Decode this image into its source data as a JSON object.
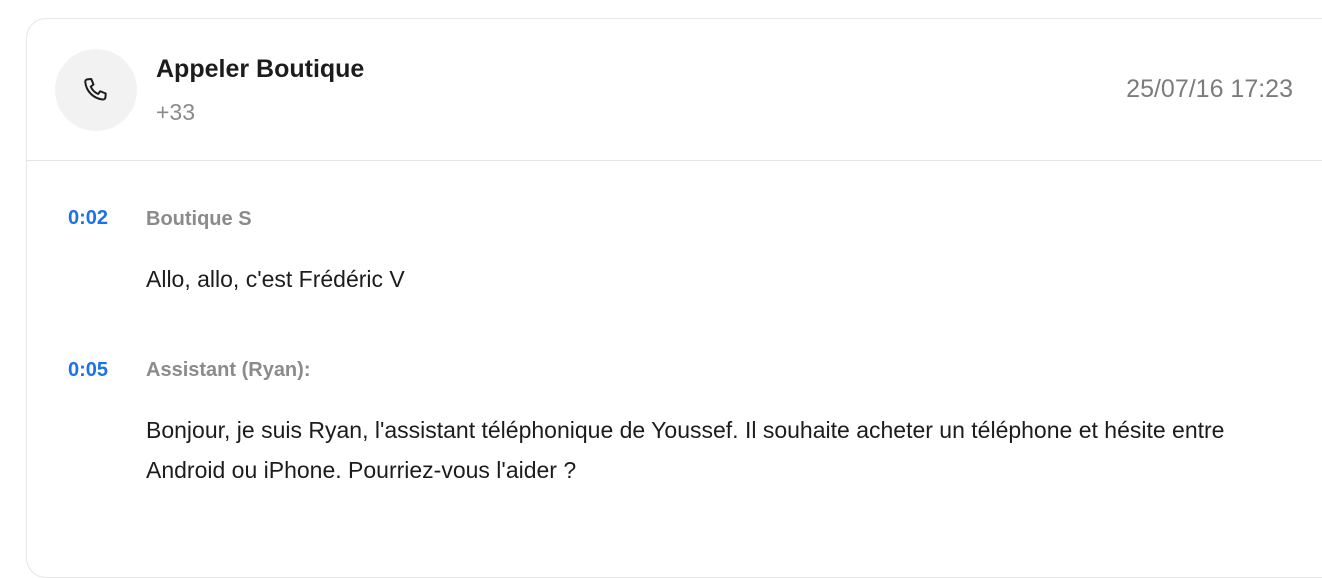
{
  "call": {
    "title": "Appeler Boutique",
    "phone": "+33",
    "timestamp": "25/07/16 17:23",
    "icon": "phone-icon"
  },
  "transcript": [
    {
      "time": "0:02",
      "speaker": "Boutique S",
      "text": "Allo, allo, c'est Frédéric V"
    },
    {
      "time": "0:05",
      "speaker": "Assistant (Ryan):",
      "text": "Bonjour, je suis Ryan, l'assistant téléphonique de Youssef. Il souhaite acheter un téléphone et hésite entre Android ou iPhone. Pourriez-vous l'aider ?"
    }
  ]
}
